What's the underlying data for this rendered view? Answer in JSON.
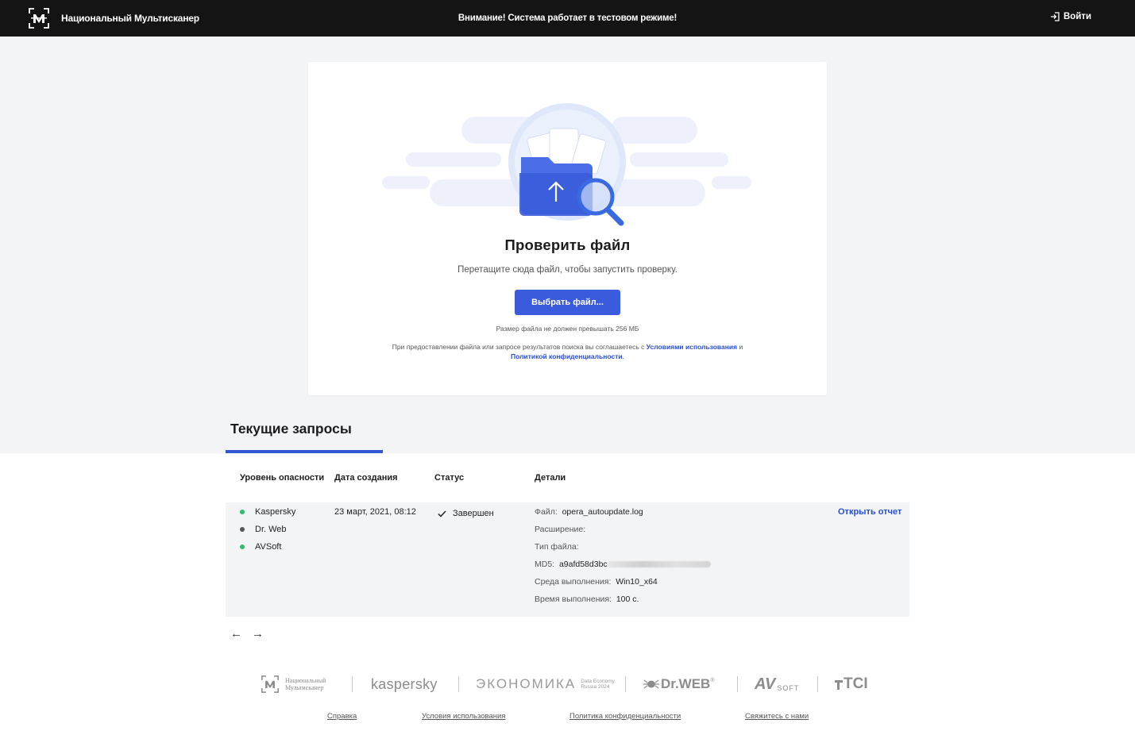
{
  "header": {
    "brand": "Национальный Мультисканер",
    "notice": "Внимание! Система работает в тестовом режиме!",
    "login_label": "Войти"
  },
  "upload": {
    "title": "Проверить файл",
    "subtitle": "Перетащите сюда файл, чтобы запустить проверку.",
    "button_label": "Выбрать файл...",
    "size_note": "Размер файла не должен превышать 256 МБ",
    "terms_prefix": "При предоставлении файла или запросе результатов поиска вы соглашаетесь с",
    "terms_link": "Условиями использования",
    "terms_and": "и",
    "privacy_link": "Политикой конфиденциальности",
    "terms_suffix": "."
  },
  "tabs": {
    "current": "Текущие запросы"
  },
  "table": {
    "headers": [
      "Уровень опасности",
      "Дата создания",
      "Статус",
      "Детали"
    ],
    "row": {
      "engines": [
        {
          "name": "Kaspersky",
          "color": "#2ebd6b"
        },
        {
          "name": "Dr. Web",
          "color": "#555555"
        },
        {
          "name": "AVSoft",
          "color": "#2ebd6b"
        }
      ],
      "date": "23 март, 2021, 08:12",
      "status": "Завершен",
      "details": {
        "file_label": "Файл:",
        "file_value": "opera_autoupdate.log",
        "ext_label": "Расширение:",
        "type_label": "Тип файла:",
        "md5_label": "MD5:",
        "md5_value": "a9afd58d3bc",
        "env_label": "Среда выполнения:",
        "env_value": "Win10_x64",
        "time_label": "Время выполнения:",
        "time_value": "100 с."
      },
      "open_report": "Открыть отчет"
    }
  },
  "pager": {
    "prev": "←",
    "next": "→"
  },
  "footer": {
    "partners": {
      "nm_line1": "Национальный",
      "nm_line2": "Мультисканер",
      "kaspersky": "kaspersky",
      "economy": "ЭКОНОМИКА",
      "economy_sub1": "Data Economy",
      "economy_sub2": "Russia 2024",
      "drweb": "Dr.WEB",
      "drweb_reg": "®",
      "avsoft_a": "AV",
      "avsoft_b": "SOFT",
      "tci": "TCI"
    },
    "links": [
      "Справка",
      "Условия использования",
      "Политика конфиденциальности",
      "Свяжитесь с нами"
    ]
  },
  "colors": {
    "accent": "#3a5cdc",
    "header_bg": "#141414",
    "band_bg": "#f3f4f6"
  }
}
